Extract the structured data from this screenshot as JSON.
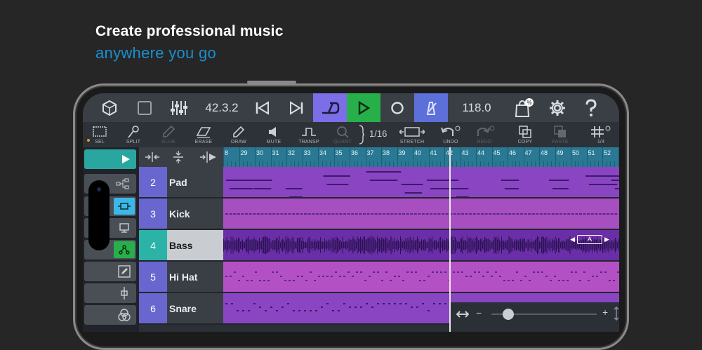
{
  "headline": "Create professional music",
  "subline": "anywhere you go",
  "transport": {
    "position": "42.3.2",
    "tempo": "118.0",
    "store_badge": "%"
  },
  "toolbar": {
    "tools": [
      {
        "label": "SEL",
        "icon": "select-icon"
      },
      {
        "label": "SPLIT",
        "icon": "split-icon"
      },
      {
        "label": "GLUE",
        "icon": "glue-icon"
      },
      {
        "label": "ERASE",
        "icon": "erase-icon"
      },
      {
        "label": "DRAW",
        "icon": "draw-icon"
      },
      {
        "label": "MUTE",
        "icon": "mute-icon"
      },
      {
        "label": "TRANSP",
        "icon": "transpose-icon"
      },
      {
        "label": "QUANT",
        "icon": "quantize-icon"
      },
      {
        "label": "STRETCH",
        "icon": "stretch-icon"
      },
      {
        "label": "UNDO",
        "icon": "undo-icon"
      },
      {
        "label": "REDO",
        "icon": "redo-icon"
      },
      {
        "label": "COPY",
        "icon": "copy-icon"
      },
      {
        "label": "PASTE",
        "icon": "paste-icon"
      },
      {
        "label": "1/4",
        "icon": "grid-icon"
      }
    ],
    "quantize_value": "1/16"
  },
  "ruler": [
    "8",
    "29",
    "30",
    "31",
    "32",
    "33",
    "34",
    "35",
    "36",
    "37",
    "38",
    "39",
    "40",
    "41",
    "42",
    "43",
    "44",
    "45",
    "46",
    "47",
    "48",
    "49",
    "50",
    "51",
    "52",
    "5"
  ],
  "tracks": [
    {
      "num": "2",
      "name": "Pad",
      "color": "#6a66cf",
      "lane": "#8a45c2"
    },
    {
      "num": "3",
      "name": "Kick",
      "color": "#6a66cf",
      "lane": "#a74fc0"
    },
    {
      "num": "4",
      "name": "Bass",
      "color": "#2ab3a6",
      "lane": "#6a2fa8",
      "selected": true
    },
    {
      "num": "5",
      "name": "Hi Hat",
      "color": "#6a66cf",
      "lane": "#b350c4"
    },
    {
      "num": "6",
      "name": "Snare",
      "color": "#6a66cf",
      "lane": "#8a45c2"
    }
  ],
  "region_label": "A",
  "colors": {
    "accent_loop": "#7b6ee8",
    "play": "#27b04a",
    "metronome": "#5d6fd8",
    "ruler": "#2a7893"
  }
}
